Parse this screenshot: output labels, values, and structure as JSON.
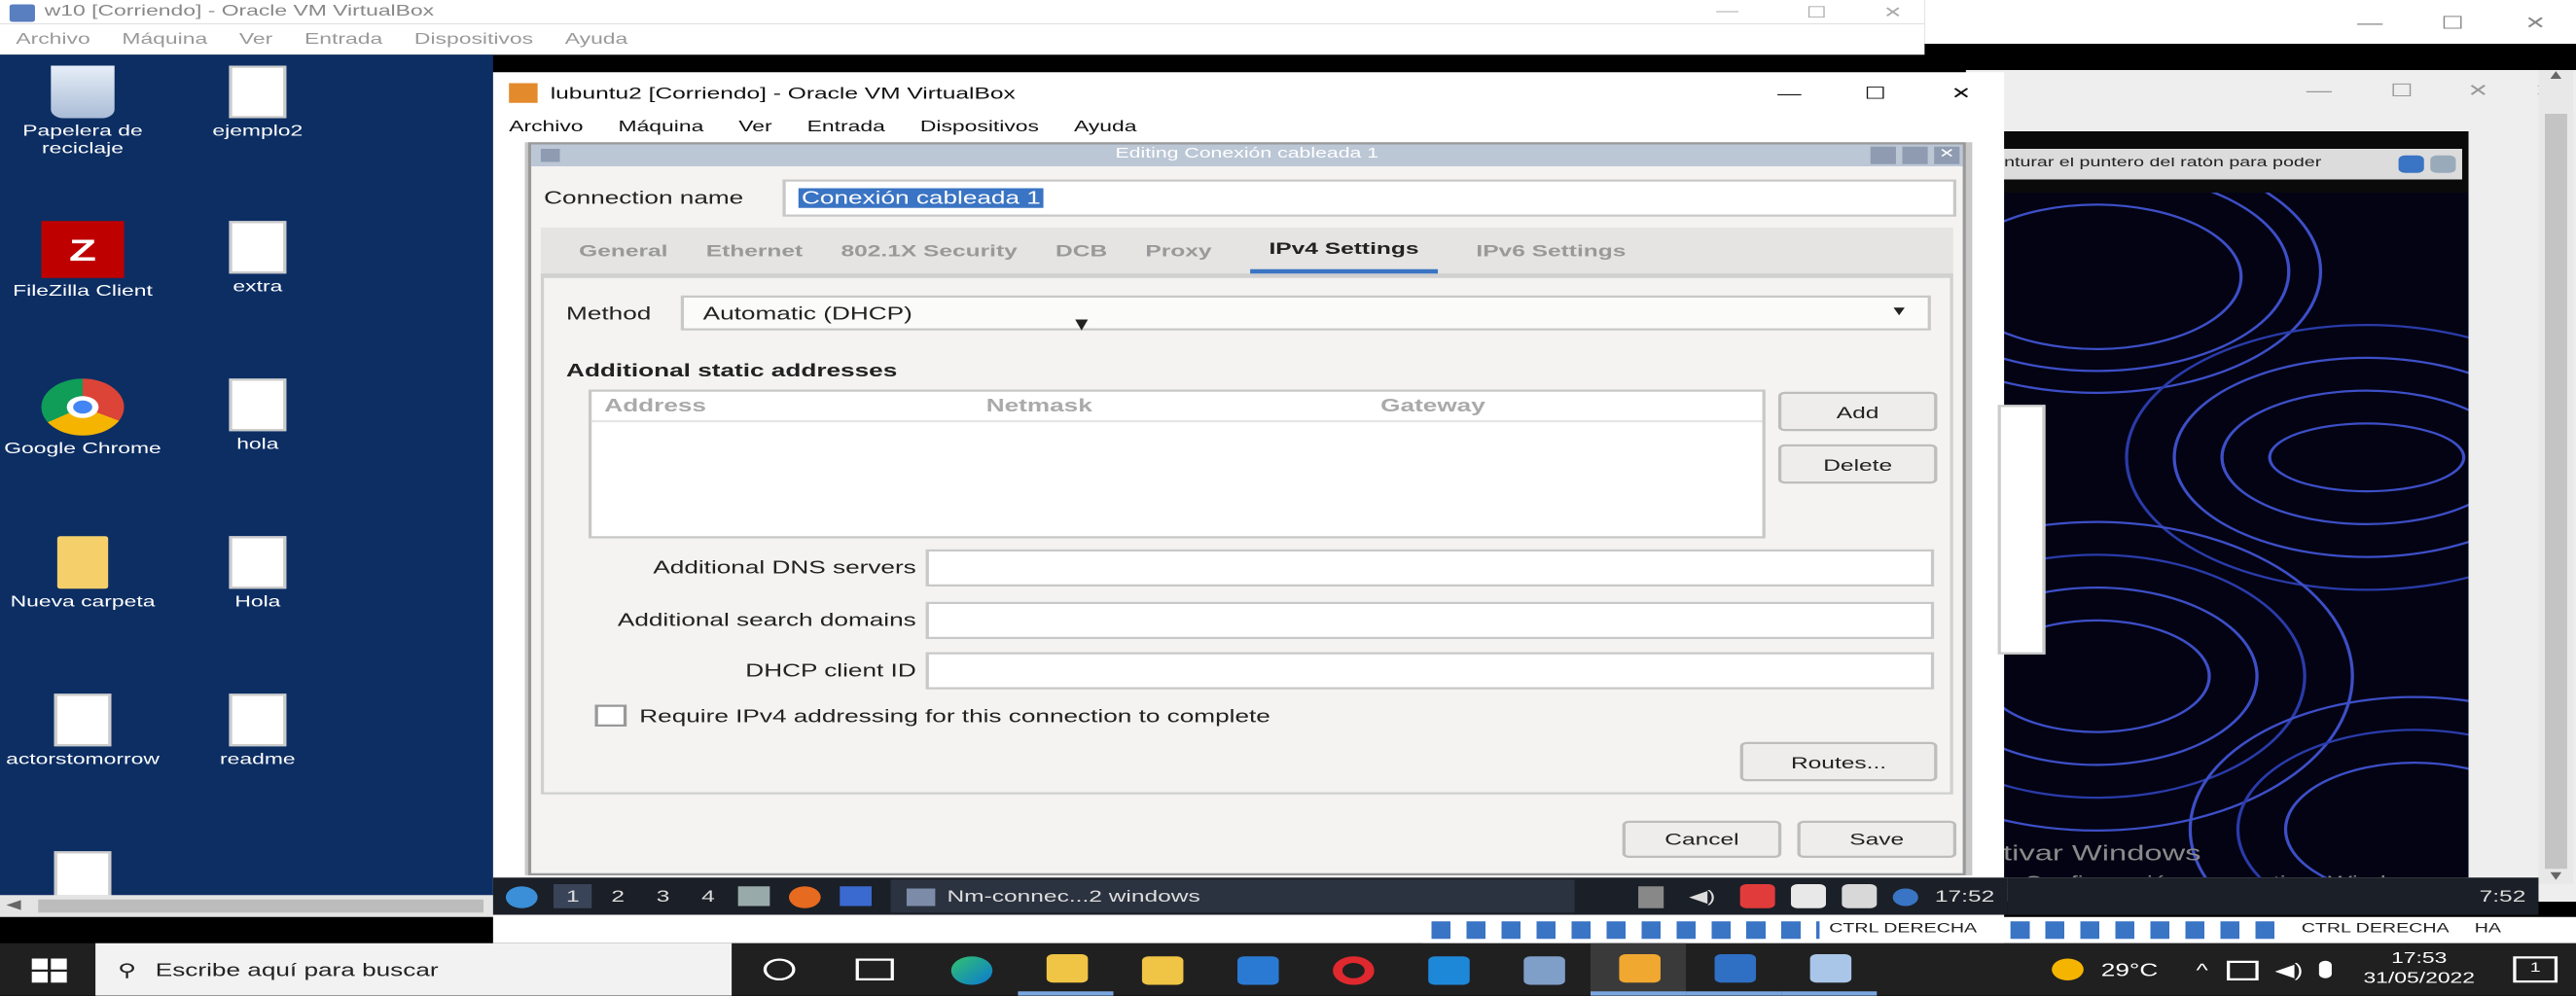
{
  "outer_window": {
    "title": "w10 [Corriendo] - Oracle VM VirtualBox",
    "menu": [
      "Archivo",
      "Máquina",
      "Ver",
      "Entrada",
      "Dispositivos",
      "Ayuda"
    ]
  },
  "desktop_icons": [
    {
      "label": "Papelera de reciclaje",
      "icon": "recycle-bin-icon"
    },
    {
      "label": "ejemplo2",
      "icon": "document-icon"
    },
    {
      "label": "FileZilla Client",
      "icon": "filezilla-icon"
    },
    {
      "label": "extra",
      "icon": "document-icon"
    },
    {
      "label": "Google Chrome",
      "icon": "chrome-icon"
    },
    {
      "label": "hola",
      "icon": "document-icon"
    },
    {
      "label": "Nueva carpeta",
      "icon": "folder-icon"
    },
    {
      "label": "Hola",
      "icon": "document-icon"
    },
    {
      "label": "actorstomorrow",
      "icon": "document-icon"
    },
    {
      "label": "readme",
      "icon": "document-icon"
    }
  ],
  "lubuntu_window": {
    "title": "lubuntu2 [Corriendo] - Oracle VM VirtualBox",
    "menu": [
      "Archivo",
      "Máquina",
      "Ver",
      "Entrada",
      "Dispositivos",
      "Ayuda"
    ]
  },
  "dialog": {
    "title": "Editing Conexión cableada 1",
    "connection_name_label": "Connection name",
    "connection_name_value": "Conexión cableada 1",
    "tabs": [
      "General",
      "Ethernet",
      "802.1X Security",
      "DCB",
      "Proxy",
      "IPv4 Settings",
      "IPv6 Settings"
    ],
    "active_tab": "IPv4 Settings",
    "method_label": "Method",
    "method_value": "Automatic (DHCP)",
    "static_heading": "Additional static addresses",
    "columns": [
      "Address",
      "Netmask",
      "Gateway"
    ],
    "add_label": "Add",
    "delete_label": "Delete",
    "dns_label": "Additional DNS servers",
    "search_label": "Additional search domains",
    "dhcp_label": "DHCP client ID",
    "dns_value": "",
    "search_value": "",
    "dhcp_value": "",
    "require_label": "Require IPv4 addressing for this connection to complete",
    "require_checked": false,
    "routes_label": "Routes...",
    "cancel_label": "Cancel",
    "save_label": "Save"
  },
  "lubuntu_panel": {
    "workspaces": [
      "1",
      "2",
      "3",
      "4"
    ],
    "task_label": "Nm-connec...2 windows",
    "clock": "17:52",
    "clock_right": "7:52"
  },
  "host_status": {
    "left_key": "CTRL DERECHA",
    "right_key": "CTRL DERECHA",
    "right_suffix": "HA"
  },
  "right_vm": {
    "capture_text": "nturar el puntero del ratón para poder",
    "activate_title": "Activar Windows",
    "activate_sub": "Ve a Configuración para activar Windows."
  },
  "taskbar": {
    "search_placeholder": "Escribe aquí para buscar",
    "weather": "29°C",
    "time": "17:53",
    "date": "31/05/2022",
    "notifications": "1"
  },
  "colors": {
    "desktop_blue": "#0c2e63",
    "accent": "#3a74c4",
    "taskbar": "#202020",
    "panel": "#1b1f27",
    "selection": "#3a74c4"
  }
}
